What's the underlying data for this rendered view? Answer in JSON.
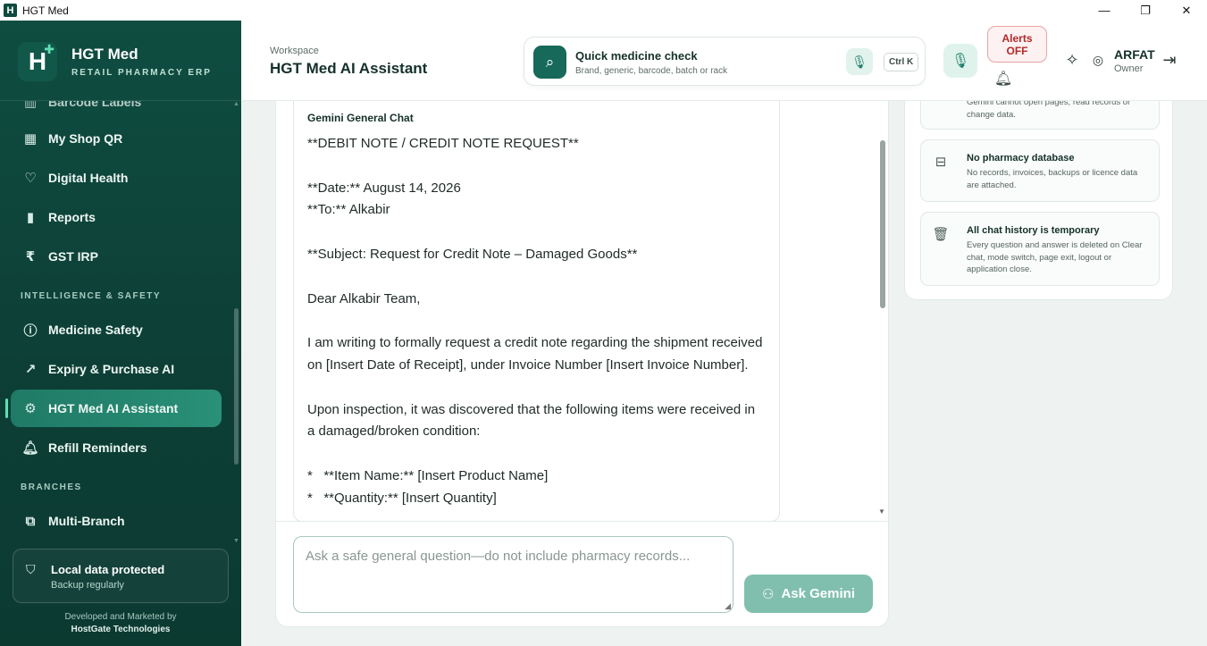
{
  "window": {
    "title": "HGT Med",
    "controls": {
      "minimize": "—",
      "maximize": "❐",
      "close": "✕"
    }
  },
  "brand": {
    "logo_letter": "H",
    "name": "HGT Med",
    "subtitle": "RETAIL PHARMACY ERP"
  },
  "sidebar": {
    "partial_top_item": "Barcode Labels",
    "items": [
      {
        "label": "My Shop QR",
        "icon": "qr-icon"
      },
      {
        "label": "Digital Health",
        "icon": "heart-pulse-icon"
      },
      {
        "label": "Reports",
        "icon": "bar-chart-icon"
      },
      {
        "label": "GST IRP",
        "icon": "rupee-document-icon"
      }
    ],
    "section_intelligence": "INTELLIGENCE & SAFETY",
    "intelligence_items": [
      {
        "label": "Medicine Safety",
        "icon": "alert-circle-icon"
      },
      {
        "label": "Expiry & Purchase AI",
        "icon": "trend-icon"
      },
      {
        "label": "HGT Med AI Assistant",
        "icon": "robot-icon",
        "active": true
      },
      {
        "label": "Refill Reminders",
        "icon": "bell-icon"
      }
    ],
    "section_branches": "BRANCHES",
    "branch_items": [
      {
        "label": "Multi-Branch",
        "icon": "network-icon"
      }
    ],
    "protect_title": "Local data protected",
    "protect_sub": "Backup regularly",
    "dev_line1": "Developed and Marketed by",
    "dev_line2": "HostGate Technologies"
  },
  "header": {
    "workspace_label": "Workspace",
    "workspace_title": "HGT Med AI Assistant",
    "quick_title": "Quick medicine check",
    "quick_sub": "Brand, generic, barcode, batch or rack",
    "shortcut": "Ctrl K",
    "alerts_line1": "Alerts",
    "alerts_line2": "OFF",
    "user_name": "ARFAT",
    "user_role": "Owner"
  },
  "chat": {
    "bubble_header": "Gemini General Chat",
    "message": "**DEBIT NOTE / CREDIT NOTE REQUEST**\n\n**Date:** August 14, 2026\n**To:** Alkabir\n\n**Subject: Request for Credit Note – Damaged Goods**\n\nDear Alkabir Team,\n\nI am writing to formally request a credit note regarding the shipment received on [Insert Date of Receipt], under Invoice Number [Insert Invoice Number].\n\nUpon inspection, it was discovered that the following items were received in a damaged/broken condition:\n\n*   **Item Name:** [Insert Product Name]\n*   **Quantity:** [Insert Quantity]",
    "input_placeholder": "Ask a safe general question—do not include pharmacy records...",
    "ask_button": "Ask Gemini"
  },
  "info_cards": [
    {
      "title": "",
      "text": "Gemini cannot open pages, read records or change data.",
      "icon": ""
    },
    {
      "title": "No pharmacy database",
      "text": "No records, invoices, backups or licence data are attached.",
      "icon": "archive-icon"
    },
    {
      "title": "All chat history is temporary",
      "text": "Every question and answer is deleted on Clear chat, mode switch, page exit, logout or application close.",
      "icon": "trash-icon"
    }
  ]
}
